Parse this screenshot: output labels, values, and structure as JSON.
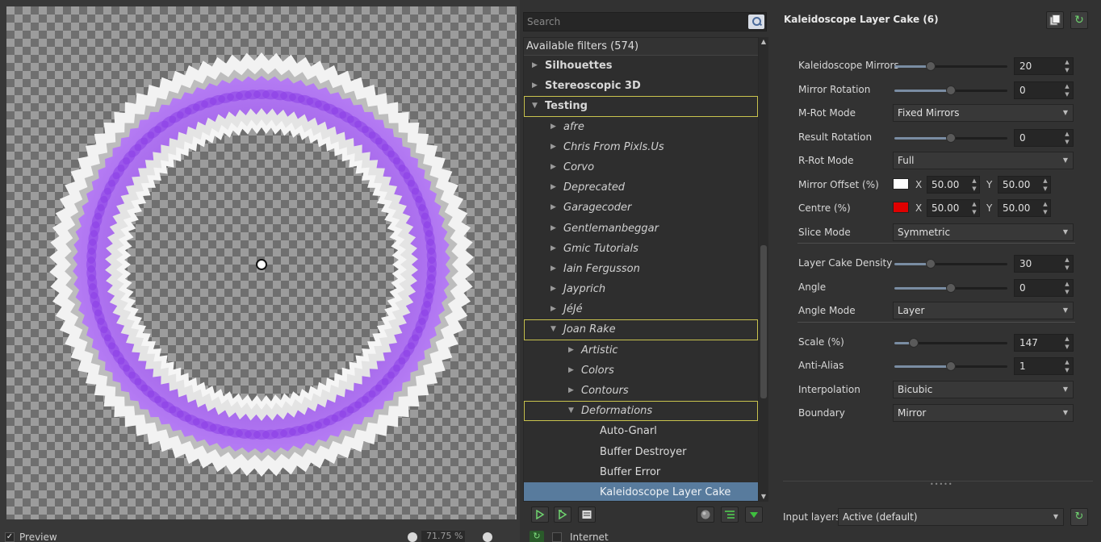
{
  "preview": {
    "checkbox_mark": "✓",
    "label": "Preview",
    "zoom": "71.75 %"
  },
  "search": {
    "placeholder": "Search"
  },
  "tree": {
    "header": "Available filters (574)",
    "rows": [
      {
        "label": "Silhouettes",
        "style": "bold",
        "level": 0,
        "arrow": "right",
        "highlight": false,
        "selected": false
      },
      {
        "label": "Stereoscopic 3D",
        "style": "bold",
        "level": 0,
        "arrow": "right",
        "highlight": false,
        "selected": false
      },
      {
        "label": "Testing",
        "style": "bold",
        "level": 0,
        "arrow": "down",
        "highlight": true,
        "selected": false
      },
      {
        "label": "afre",
        "style": "italic",
        "level": 1,
        "arrow": "right",
        "highlight": false,
        "selected": false
      },
      {
        "label": "Chris From Pixls.Us",
        "style": "italic",
        "level": 1,
        "arrow": "right",
        "highlight": false,
        "selected": false
      },
      {
        "label": "Corvo",
        "style": "italic",
        "level": 1,
        "arrow": "right",
        "highlight": false,
        "selected": false
      },
      {
        "label": "Deprecated",
        "style": "italic",
        "level": 1,
        "arrow": "right",
        "highlight": false,
        "selected": false
      },
      {
        "label": "Garagecoder",
        "style": "italic",
        "level": 1,
        "arrow": "right",
        "highlight": false,
        "selected": false
      },
      {
        "label": "Gentlemanbeggar",
        "style": "italic",
        "level": 1,
        "arrow": "right",
        "highlight": false,
        "selected": false
      },
      {
        "label": "Gmic Tutorials",
        "style": "italic",
        "level": 1,
        "arrow": "right",
        "highlight": false,
        "selected": false
      },
      {
        "label": "Iain Fergusson",
        "style": "italic",
        "level": 1,
        "arrow": "right",
        "highlight": false,
        "selected": false
      },
      {
        "label": "Jayprich",
        "style": "italic",
        "level": 1,
        "arrow": "right",
        "highlight": false,
        "selected": false
      },
      {
        "label": "JéJé",
        "style": "italic",
        "level": 1,
        "arrow": "right",
        "highlight": false,
        "selected": false
      },
      {
        "label": "Joan Rake",
        "style": "italic",
        "level": 1,
        "arrow": "down",
        "highlight": true,
        "selected": false
      },
      {
        "label": "Artistic",
        "style": "italic",
        "level": 2,
        "arrow": "right",
        "highlight": false,
        "selected": false
      },
      {
        "label": "Colors",
        "style": "italic",
        "level": 2,
        "arrow": "right",
        "highlight": false,
        "selected": false
      },
      {
        "label": "Contours",
        "style": "italic",
        "level": 2,
        "arrow": "right",
        "highlight": false,
        "selected": false
      },
      {
        "label": "Deformations",
        "style": "italic",
        "level": 2,
        "arrow": "down",
        "highlight": true,
        "selected": false
      },
      {
        "label": "Auto-Gnarl",
        "style": "plain",
        "level": 3,
        "arrow": "",
        "highlight": false,
        "selected": false
      },
      {
        "label": "Buffer Destroyer",
        "style": "plain",
        "level": 3,
        "arrow": "",
        "highlight": false,
        "selected": false
      },
      {
        "label": "Buffer Error",
        "style": "plain",
        "level": 3,
        "arrow": "",
        "highlight": false,
        "selected": false
      },
      {
        "label": "Kaleidoscope Layer Cake",
        "style": "plain",
        "level": 3,
        "arrow": "",
        "highlight": false,
        "selected": true
      }
    ]
  },
  "internet": {
    "label": "Internet"
  },
  "filter": {
    "title": "Kaleidoscope Layer Cake (6)",
    "params": [
      {
        "label": "Kaleidoscope Mirrors",
        "kind": "slider",
        "value": "20",
        "level": 0.32
      },
      {
        "label": "Mirror Rotation",
        "kind": "slider",
        "value": "0",
        "level": 0.5
      },
      {
        "label": "M-Rot Mode",
        "kind": "combo",
        "value": "Fixed Mirrors"
      },
      {
        "label": "Result Rotation",
        "kind": "slider",
        "value": "0",
        "level": 0.5
      },
      {
        "label": "R-Rot Mode",
        "kind": "combo",
        "value": "Full"
      },
      {
        "label": "Mirror Offset (%)",
        "kind": "point",
        "color": "#ffffff",
        "x_label": "X",
        "x": "50.00",
        "y_label": "Y",
        "y": "50.00"
      },
      {
        "label": "Centre (%)",
        "kind": "point",
        "color": "#e00000",
        "x_label": "X",
        "x": "50.00",
        "y_label": "Y",
        "y": "50.00"
      },
      {
        "label": "Slice Mode",
        "kind": "combo",
        "value": "Symmetric"
      },
      {
        "kind": "separator"
      },
      {
        "label": "Layer Cake Density",
        "kind": "slider",
        "value": "30",
        "level": 0.32
      },
      {
        "label": "Angle",
        "kind": "slider",
        "value": "0",
        "level": 0.5
      },
      {
        "label": "Angle Mode",
        "kind": "combo",
        "value": "Layer"
      },
      {
        "kind": "separator"
      },
      {
        "label": "Scale (%)",
        "kind": "slider",
        "value": "147",
        "level": 0.17
      },
      {
        "label": "Anti-Alias",
        "kind": "slider",
        "value": "1",
        "level": 0.5
      },
      {
        "label": "Interpolation",
        "kind": "combo",
        "value": "Bicubic"
      },
      {
        "label": "Boundary",
        "kind": "combo",
        "value": "Mirror"
      }
    ]
  },
  "input_layers": {
    "label": "Input layers",
    "value": "Active (default)"
  },
  "colors": {
    "accent_selection": "#587b9d",
    "highlight_outline": "#c9c34e",
    "ring_purple": "#9a4be8"
  },
  "icons": [
    "search-icon",
    "refresh-icon",
    "add-favorite-icon",
    "remove-favorite-icon",
    "rename-icon",
    "globe-icon",
    "expand-icon",
    "download-icon",
    "copy-icon",
    "zoom-out-icon",
    "zoom-in-icon",
    "redo-icon"
  ]
}
